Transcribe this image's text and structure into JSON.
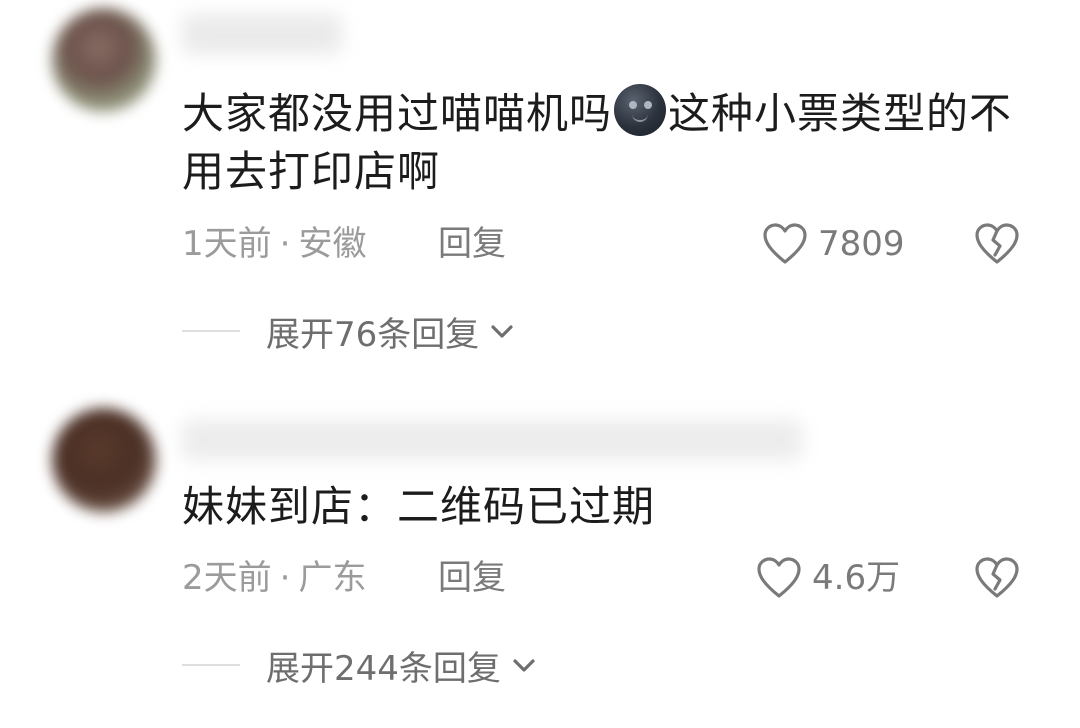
{
  "comments": [
    {
      "content_before": "大家都没用过喵喵机吗",
      "emoji": "new-moon-face-emoji",
      "content_after": "这种小票类型的不用去打印店啊",
      "time": "1天前",
      "separator": "·",
      "location": "安徽",
      "reply_label": "回复",
      "like_count": "7809",
      "expand_label": "展开76条回复"
    },
    {
      "content": "妹妹到店：二维码已过期",
      "time": "2天前",
      "separator": "·",
      "location": "广东",
      "reply_label": "回复",
      "like_count": "4.6万",
      "expand_label": "展开244条回复"
    }
  ],
  "icons": {
    "like": "heart-outline-icon",
    "dislike": "broken-heart-icon",
    "expand": "chevron-down-icon"
  },
  "colors": {
    "text_primary": "#1c1c1c",
    "text_secondary": "#9b9b9b",
    "icon": "#7a7a7a",
    "background": "#ffffff"
  }
}
